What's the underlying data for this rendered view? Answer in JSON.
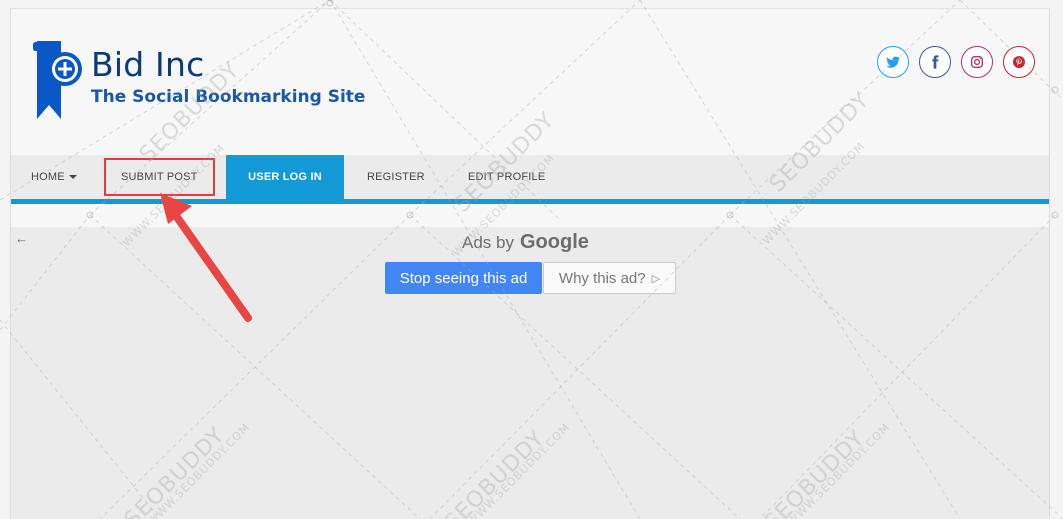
{
  "site": {
    "name": "Bid Inc",
    "tagline": "The Social Bookmarking Site"
  },
  "social": [
    {
      "name": "twitter",
      "color": "#1da1f2"
    },
    {
      "name": "facebook",
      "color": "#3b5998"
    },
    {
      "name": "instagram",
      "color": "#b5316f"
    },
    {
      "name": "pinterest",
      "color": "#c8232c"
    }
  ],
  "nav": {
    "home": "HOME",
    "submit_post": "SUBMIT POST",
    "user_log_in": "USER LOG IN",
    "register": "REGISTER",
    "edit_profile": "EDIT PROFILE"
  },
  "ad": {
    "ads_by": "Ads by",
    "google": "Google",
    "stop_label": "Stop seeing this ad",
    "why_label": "Why this ad?"
  },
  "watermark": {
    "brand": "SEOBUDDY",
    "domain": "WWW.SEOBUDDY.COM"
  },
  "colors": {
    "accent": "#139ad6",
    "logo": "#0a3b7a",
    "annotation": "#e33b3b",
    "google_blue": "#4285f4"
  }
}
